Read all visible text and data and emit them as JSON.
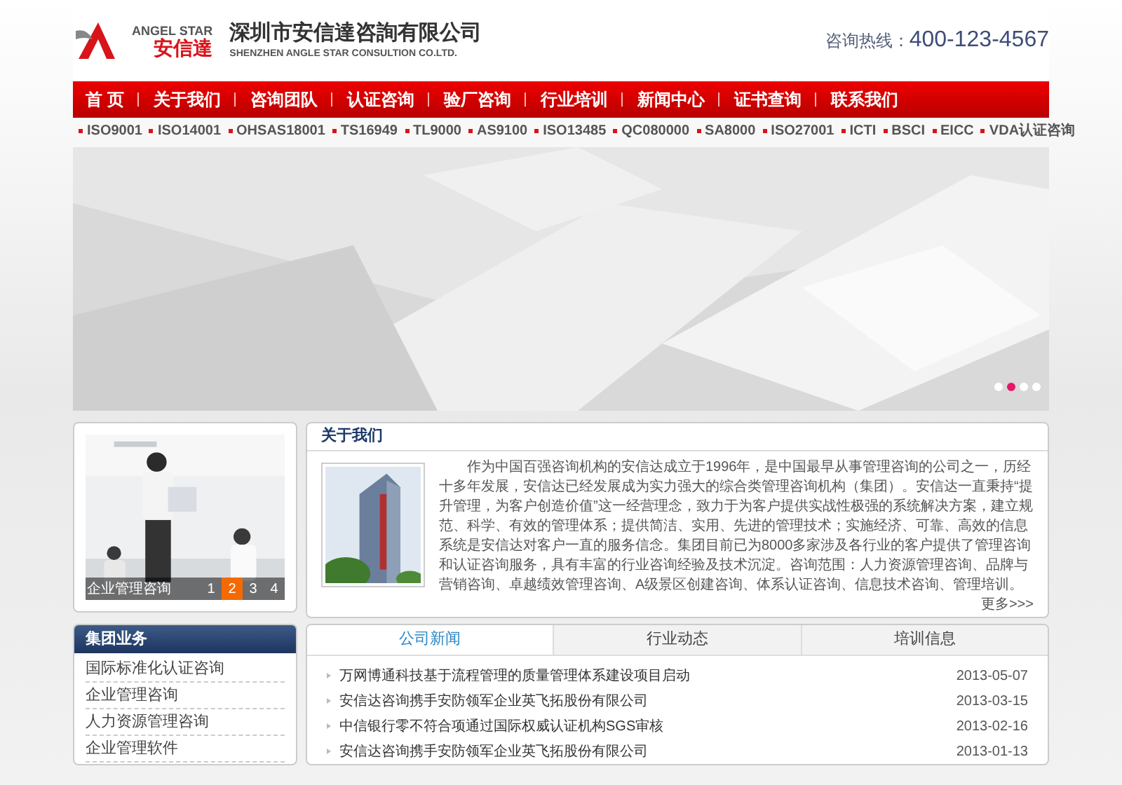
{
  "header": {
    "logo_en": "ANGEL STAR",
    "logo_cn": "安信達",
    "company_cn": "深圳市安信達咨詢有限公司",
    "company_en": "SHENZHEN ANGLE STAR CONSULTION CO.LTD.",
    "hotline_label": "咨询热线：",
    "hotline": "400-123-4567"
  },
  "nav": [
    "首 页",
    "关于我们",
    "咨询团队",
    "认证咨询",
    "验厂咨询",
    "行业培训",
    "新闻中心",
    "证书查询",
    "联系我们"
  ],
  "cert_links": [
    "ISO9001",
    "ISO14001",
    "OHSAS18001",
    "TS16949",
    "TL9000",
    "AS9100",
    "ISO13485",
    "QC080000",
    "SA8000",
    "ISO27001",
    "ICTI",
    "BSCI",
    "EICC",
    "VDA认证咨询"
  ],
  "banner": {
    "kind": "picture",
    "dots": [
      {
        "selected": false
      },
      {
        "selected": true
      },
      {
        "selected": false
      },
      {
        "selected": false
      }
    ]
  },
  "showcase": {
    "caption": "企业管理咨询",
    "pages": [
      {
        "label": "1",
        "selected": false
      },
      {
        "label": "2",
        "selected": true
      },
      {
        "label": "3",
        "selected": false
      },
      {
        "label": "4",
        "selected": false
      }
    ]
  },
  "about": {
    "title": "关于我们",
    "text": "作为中国百强咨询机构的安信达成立于1996年，是中国最早从事管理咨询的公司之一，历经十多年发展，安信达已经发展成为实力强大的综合类管理咨询机构（集团）。安信达一直秉持“提升管理，为客户创造价值”这一经营理念，致力于为客户提供实战性极强的系统解决方案，建立规范、科学、有效的管理体系；提供简洁、实用、先进的管理技术；实施经济、可靠、高效的信息系统是安信达对客户一直的服务信念。集团目前已为8000多家涉及各行业的客户提供了管理咨询和认证咨询服务，具有丰富的行业咨询经验及技术沉淀。咨询范围：人力资源管理咨询、品牌与营销咨询、卓越绩效管理咨询、A级景区创建咨询、体系认证咨询、信息技术咨询、管理培训。",
    "more": "更多>>>"
  },
  "business": {
    "title": "集团业务",
    "items": [
      "国际标准化认证咨询",
      "企业管理咨询",
      "人力资源管理咨询",
      "企业管理软件"
    ]
  },
  "news": {
    "tabs": [
      {
        "label": "公司新闻",
        "selected": true
      },
      {
        "label": "行业动态",
        "selected": false
      },
      {
        "label": "培训信息",
        "selected": false
      }
    ],
    "items": [
      {
        "title": "万网博通科技基于流程管理的质量管理体系建设项目启动",
        "date": "2013-05-07"
      },
      {
        "title": "安信达咨询携手安防领军企业英飞拓股份有限公司",
        "date": "2013-03-15"
      },
      {
        "title": "中信银行零不符合项通过国际权威认证机构SGS审核",
        "date": "2013-02-16"
      },
      {
        "title": "安信达咨询携手安防领军企业英飞拓股份有限公司",
        "date": "2013-01-13"
      }
    ]
  }
}
